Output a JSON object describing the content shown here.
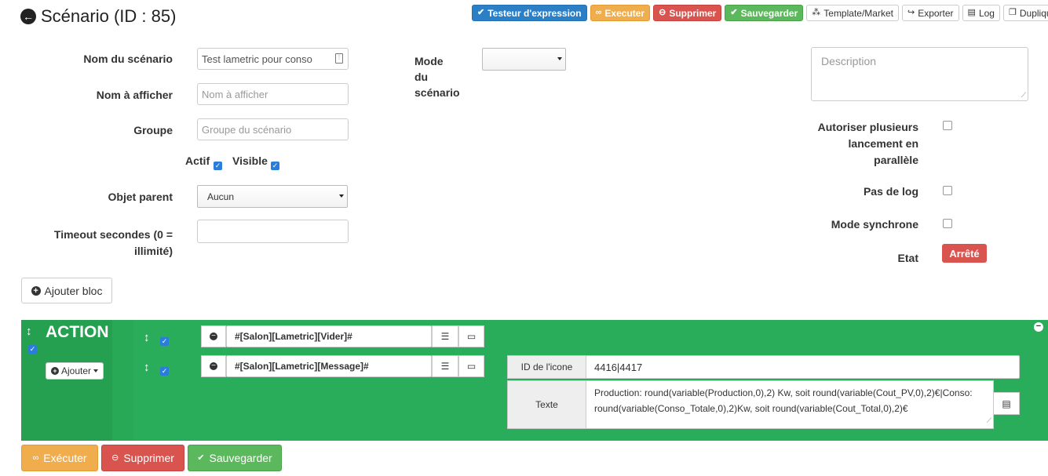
{
  "header": {
    "title": "Scénario (ID : 85)",
    "buttons": {
      "testeur": "Testeur d'expression",
      "executer": "Executer",
      "supprimer": "Supprimer",
      "sauvegarder": "Sauvegarder",
      "template": "Template/Market",
      "exporter": "Exporter",
      "log": "Log",
      "dupliquer": "Dupliquer"
    }
  },
  "form": {
    "nom_label": "Nom du scénario",
    "nom_value": "Test lametric pour conso",
    "afficher_label": "Nom à afficher",
    "afficher_placeholder": "Nom à afficher",
    "groupe_label": "Groupe",
    "groupe_placeholder": "Groupe du scénario",
    "actif_label": "Actif",
    "visible_label": "Visible",
    "objet_label": "Objet parent",
    "objet_value": "Aucun",
    "timeout_label_1": "Timeout secondes (0 =",
    "timeout_label_2": "illimité)",
    "mode_label_1": "Mode du",
    "mode_label_2": "scénario",
    "mode_value": "",
    "description_placeholder": "Description",
    "autoriser_1": "Autoriser plusieurs",
    "autoriser_2": "lancement en",
    "autoriser_3": "parallèle",
    "pas_de_log": "Pas de log",
    "mode_synchrone": "Mode synchrone",
    "etat_label": "Etat",
    "etat_value": "Arrêté",
    "etat_color": "#d9534f"
  },
  "ajouter_bloc": "Ajouter bloc",
  "block": {
    "type": "ACTION",
    "ajouter": "Ajouter",
    "actions": [
      {
        "command": "#[Salon][Lametric][Vider]#"
      },
      {
        "command": "#[Salon][Lametric][Message]#"
      }
    ],
    "options": {
      "id_label": "ID de l'icone",
      "id_value": "4416|4417",
      "texte_label": "Texte",
      "texte_value": "Production: round(variable(Production,0),2) Kw, soit round(variable(Cout_PV,0),2)€|Conso: round(variable(Conso_Totale,0),2)Kw, soit round(variable(Cout_Total,0),2)€"
    },
    "color": "#28a955"
  },
  "bottom": {
    "executer": "Exécuter",
    "supprimer": "Supprimer",
    "sauvegarder": "Sauvegarder"
  }
}
